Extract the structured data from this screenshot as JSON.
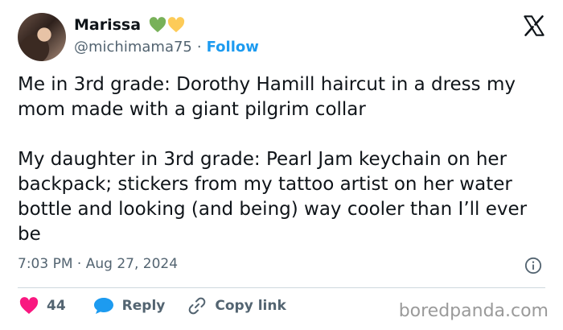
{
  "user": {
    "name": "Marissa",
    "handle": "@michimama75",
    "separator": "·",
    "follow_label": "Follow",
    "emoji_hearts": [
      "green-heart-icon",
      "yellow-heart-icon"
    ]
  },
  "tweet": {
    "text": "Me in 3rd grade: Dorothy Hamill haircut in a dress my mom made with a giant pilgrim collar\n\nMy daughter in 3rd grade: Pearl Jam keychain on her backpack; stickers from my tattoo artist on her water bottle and looking (and being) way cooler than I’ll ever be",
    "time": "7:03 PM",
    "date": "Aug 27, 2024",
    "time_separator": "·"
  },
  "actions": {
    "like_count": "44",
    "reply_label": "Reply",
    "copy_link_label": "Copy link"
  },
  "watermark": "boredpanda.com",
  "colors": {
    "link_blue": "#1d9bf0",
    "like_pink": "#f91880",
    "secondary_text": "#536471",
    "heart_green": "#78b159",
    "heart_yellow": "#fdcb58"
  }
}
